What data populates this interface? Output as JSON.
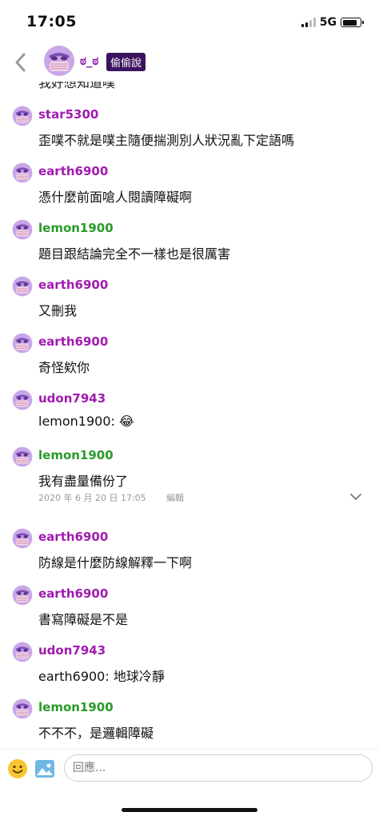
{
  "status": {
    "time": "17:05",
    "network": "5G",
    "battery_level": 0.85
  },
  "header": {
    "name": "ಠ_ಠ",
    "badge": "偷偷說"
  },
  "partial_message": "我好想知道噗",
  "messages": [
    {
      "user": "star5300",
      "text": "歪噗不就是噗主隨便揣測別人狀況亂下定語嗎",
      "color": "purple"
    },
    {
      "user": "earth6900",
      "text": "憑什麼前面嗆人閱讀障礙啊",
      "color": "purple"
    },
    {
      "user": "lemon1900",
      "text": "題目跟結論完全不一樣也是很厲害",
      "color": "green"
    },
    {
      "user": "earth6900",
      "text": "又刪我",
      "color": "purple"
    },
    {
      "user": "earth6900",
      "text": "奇怪欸你",
      "color": "purple"
    },
    {
      "user": "udon7943",
      "text": "lemon1900: 😂",
      "color": "purple"
    },
    {
      "user": "lemon1900",
      "text": "我有盡量備份了",
      "color": "green"
    },
    {
      "user": "earth6900",
      "text": "防線是什麼防線解釋一下啊",
      "color": "purple"
    },
    {
      "user": "earth6900",
      "text": "書寫障礙是不是",
      "color": "purple"
    },
    {
      "user": "udon7943",
      "text": "earth6900: 地球冷靜",
      "color": "purple"
    },
    {
      "user": "lemon1900",
      "text": "不不不，是邏輯障礙",
      "color": "green"
    }
  ],
  "post_meta": {
    "date": "2020 年 6 月 20 日 17:05",
    "edit_label": "編輯"
  },
  "reply": {
    "placeholder": "回應..."
  },
  "colors": {
    "purple": "#a01bb0",
    "green": "#2a9a2a",
    "badge_bg": "#3c1361"
  },
  "icons": [
    "back-chevron-icon",
    "mask-avatar-icon",
    "emoji-icon",
    "image-icon",
    "expand-chevron-icon"
  ]
}
